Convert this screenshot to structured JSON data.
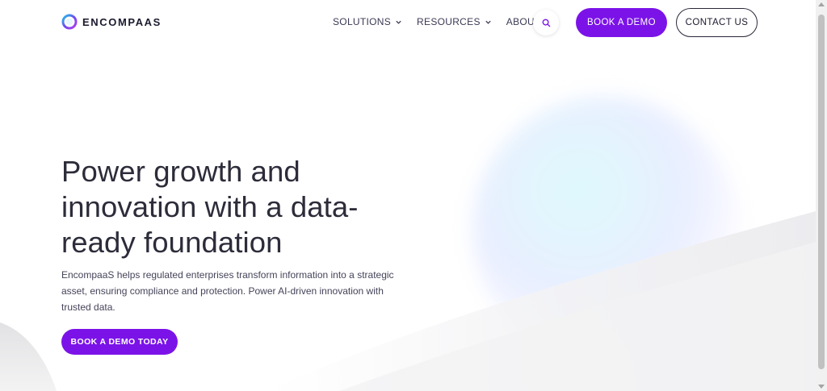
{
  "brand": {
    "name": "ENCOMPAAS",
    "logo_icon": "encompaas-ring-logo",
    "accent_color": "#7b13e8"
  },
  "nav": {
    "items": [
      {
        "label": "SOLUTIONS",
        "icon": "chevron-down-icon"
      },
      {
        "label": "RESOURCES",
        "icon": "chevron-down-icon"
      },
      {
        "label": "ABOUT",
        "icon": "chevron-down-icon"
      }
    ],
    "search_icon": "search-icon",
    "book_demo_label": "BOOK A DEMO",
    "contact_label": "CONTACT US"
  },
  "hero": {
    "title": "Power growth and innovation with a data-ready foundation",
    "description": "EncompaaS helps regulated enterprises transform information into a strategic asset, ensuring compliance and protection. Power AI-driven innovation with trusted data.",
    "cta_label": "BOOK A DEMO TODAY"
  }
}
